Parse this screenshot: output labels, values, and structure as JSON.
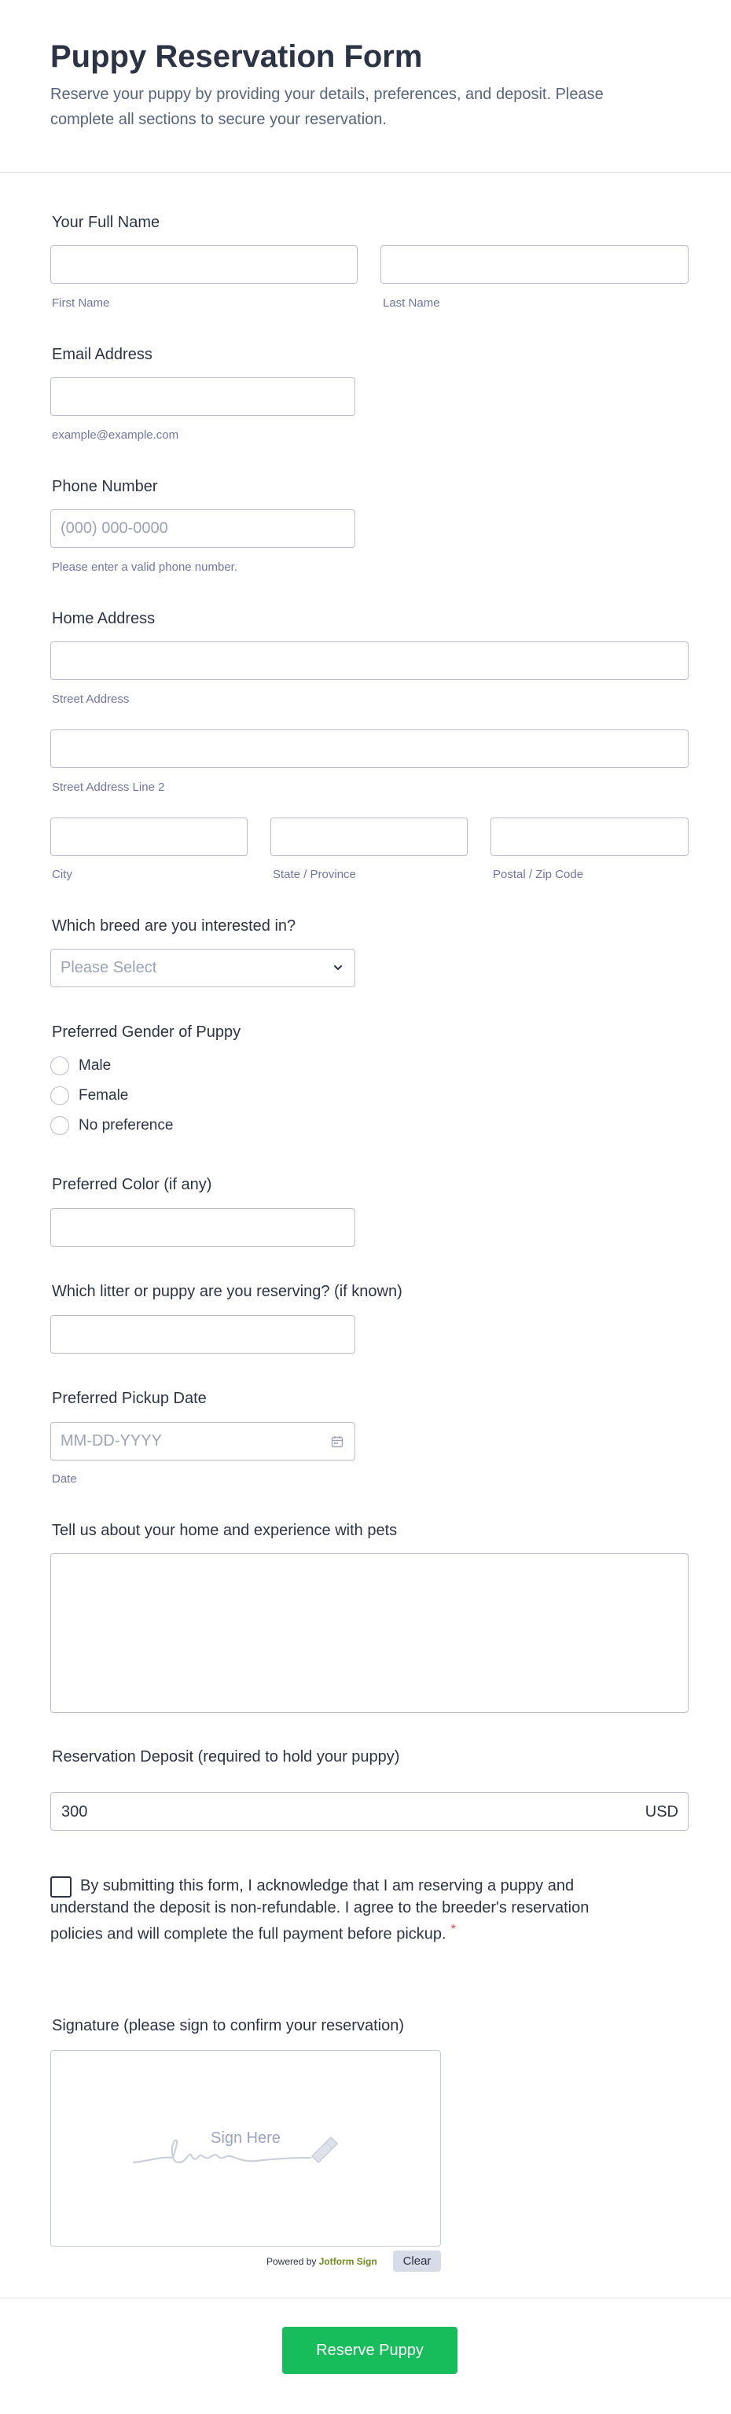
{
  "header": {
    "title": "Puppy Reservation Form",
    "subtitle": "Reserve your puppy by providing your details, preferences, and deposit. Please complete all sections to secure your reservation."
  },
  "name": {
    "label": "Your Full Name",
    "first_sublabel": "First Name",
    "last_sublabel": "Last Name"
  },
  "email": {
    "label": "Email Address",
    "sublabel": "example@example.com"
  },
  "phone": {
    "label": "Phone Number",
    "placeholder": "(000) 000-0000",
    "sublabel": "Please enter a valid phone number."
  },
  "address": {
    "label": "Home Address",
    "street_sublabel": "Street Address",
    "street2_sublabel": "Street Address Line 2",
    "city_sublabel": "City",
    "state_sublabel": "State / Province",
    "zip_sublabel": "Postal / Zip Code"
  },
  "breed": {
    "label": "Which breed are you interested in?",
    "placeholder": "Please Select"
  },
  "gender": {
    "label": "Preferred Gender of Puppy",
    "options": [
      "Male",
      "Female",
      "No preference"
    ]
  },
  "color": {
    "label": "Preferred Color (if any)"
  },
  "litter": {
    "label": "Which litter or puppy are you reserving? (if known)"
  },
  "pickup": {
    "label": "Preferred Pickup Date",
    "placeholder": "MM-DD-YYYY",
    "sublabel": "Date"
  },
  "experience": {
    "label": "Tell us about your home and experience with pets"
  },
  "deposit": {
    "label": "Reservation Deposit (required to hold your puppy)",
    "value": "300",
    "currency": "USD"
  },
  "agreement": {
    "text": "By submitting this form, I acknowledge that I am reserving a puppy and understand the deposit is non-refundable. I agree to the breeder's reservation policies and will complete the full payment before pickup.",
    "required_mark": "*"
  },
  "signature": {
    "label": "Signature (please sign to confirm your reservation)",
    "hint": "Sign Here",
    "powered_by": "Powered by",
    "brand": "Jotform Sign",
    "clear_label": "Clear"
  },
  "submit": {
    "label": "Reserve Puppy"
  },
  "colors": {
    "accent": "#18bd5b",
    "required": "#f23a3c",
    "text": "#2c3345",
    "sublabel": "#6f76a7"
  }
}
